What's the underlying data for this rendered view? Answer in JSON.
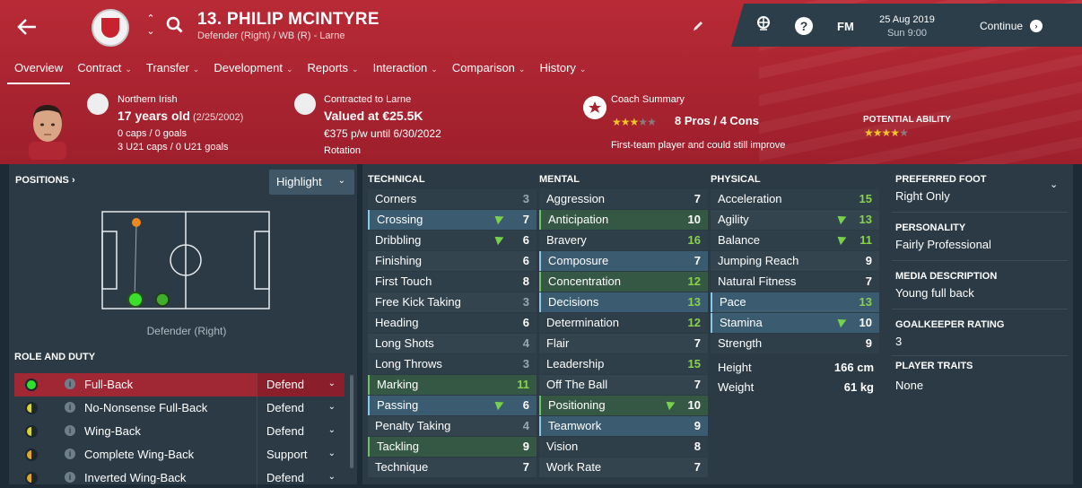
{
  "header": {
    "player_name": "13. PHILIP MCINTYRE",
    "player_sub": "Defender (Right) / WB (R) - Larne",
    "fm_label": "FM",
    "date": "25 Aug 2019",
    "time": "Sun 9:00",
    "continue_label": "Continue",
    "help_label": "?"
  },
  "nav": [
    {
      "label": "Overview",
      "active": true
    },
    {
      "label": "Contract"
    },
    {
      "label": "Transfer"
    },
    {
      "label": "Development"
    },
    {
      "label": "Reports"
    },
    {
      "label": "Interaction"
    },
    {
      "label": "Comparison"
    },
    {
      "label": "History"
    }
  ],
  "info": {
    "nationality": "Northern Irish",
    "age": "17 years old",
    "dob": "(2/25/2002)",
    "caps": "0 caps / 0 goals",
    "u21caps": "3 U21 caps / 0 U21 goals",
    "contract_label": "Contracted to Larne",
    "value": "Valued at €25.5K",
    "wage": "€375 p/w until 6/30/2022",
    "status": "Rotation",
    "coach_label": "Coach Summary",
    "coach_stars": 3,
    "pros_cons": "8 Pros / 4 Cons",
    "coach_note": "First-team player and could still improve",
    "pa_label": "POTENTIAL ABILITY",
    "pa_stars": 4
  },
  "positions": {
    "title": "POSITIONS ›",
    "highlight_label": "Highlight",
    "label": "Defender (Right)"
  },
  "roles": {
    "title": "ROLE AND DUTY",
    "info_glyph": "i",
    "items": [
      {
        "name": "Full-Back",
        "duty": "Defend",
        "selected": true,
        "color": "#2fe02f",
        "half": false
      },
      {
        "name": "No-Nonsense Full-Back",
        "duty": "Defend",
        "color": "#d8d430",
        "half": true
      },
      {
        "name": "Wing-Back",
        "duty": "Defend",
        "color": "#d8d430",
        "half": true
      },
      {
        "name": "Complete Wing-Back",
        "duty": "Support",
        "color": "#e0a82a",
        "half": true
      },
      {
        "name": "Inverted Wing-Back",
        "duty": "Defend",
        "color": "#e0a82a",
        "half": true
      }
    ]
  },
  "technical": {
    "title": "TECHNICAL",
    "rows": [
      {
        "n": "Corners",
        "v": "3",
        "style": "plain",
        "vc": "grey"
      },
      {
        "n": "Crossing",
        "v": "7",
        "style": "blue",
        "arrow": true,
        "vc": "white"
      },
      {
        "n": "Dribbling",
        "v": "6",
        "style": "plain",
        "arrow": true,
        "vc": "white"
      },
      {
        "n": "Finishing",
        "v": "6",
        "style": "alt",
        "vc": "white"
      },
      {
        "n": "First Touch",
        "v": "8",
        "style": "plain",
        "vc": "white"
      },
      {
        "n": "Free Kick Taking",
        "v": "3",
        "style": "alt",
        "vc": "grey"
      },
      {
        "n": "Heading",
        "v": "6",
        "style": "plain",
        "vc": "white"
      },
      {
        "n": "Long Shots",
        "v": "4",
        "style": "alt",
        "vc": "grey"
      },
      {
        "n": "Long Throws",
        "v": "3",
        "style": "plain",
        "vc": "grey"
      },
      {
        "n": "Marking",
        "v": "11",
        "style": "green",
        "vc": "green"
      },
      {
        "n": "Passing",
        "v": "6",
        "style": "blue",
        "arrow": true,
        "vc": "white"
      },
      {
        "n": "Penalty Taking",
        "v": "4",
        "style": "alt",
        "vc": "grey"
      },
      {
        "n": "Tackling",
        "v": "9",
        "style": "green",
        "vc": "white"
      },
      {
        "n": "Technique",
        "v": "7",
        "style": "alt",
        "vc": "white"
      }
    ]
  },
  "mental": {
    "title": "MENTAL",
    "rows": [
      {
        "n": "Aggression",
        "v": "7",
        "style": "plain",
        "vc": "white"
      },
      {
        "n": "Anticipation",
        "v": "10",
        "style": "green",
        "vc": "white"
      },
      {
        "n": "Bravery",
        "v": "16",
        "style": "plain",
        "vc": "green"
      },
      {
        "n": "Composure",
        "v": "7",
        "style": "blue",
        "vc": "white"
      },
      {
        "n": "Concentration",
        "v": "12",
        "style": "green",
        "vc": "green"
      },
      {
        "n": "Decisions",
        "v": "13",
        "style": "blue",
        "vc": "green"
      },
      {
        "n": "Determination",
        "v": "12",
        "style": "plain",
        "vc": "green"
      },
      {
        "n": "Flair",
        "v": "7",
        "style": "alt",
        "vc": "white"
      },
      {
        "n": "Leadership",
        "v": "15",
        "style": "plain",
        "vc": "green"
      },
      {
        "n": "Off The Ball",
        "v": "7",
        "style": "alt",
        "vc": "white"
      },
      {
        "n": "Positioning",
        "v": "10",
        "style": "green",
        "arrow": true,
        "vc": "white"
      },
      {
        "n": "Teamwork",
        "v": "9",
        "style": "blue",
        "vc": "white"
      },
      {
        "n": "Vision",
        "v": "8",
        "style": "plain",
        "vc": "white"
      },
      {
        "n": "Work Rate",
        "v": "7",
        "style": "alt",
        "vc": "white"
      }
    ]
  },
  "physical": {
    "title": "PHYSICAL",
    "rows": [
      {
        "n": "Acceleration",
        "v": "15",
        "style": "plain",
        "vc": "green"
      },
      {
        "n": "Agility",
        "v": "13",
        "style": "alt",
        "arrow": true,
        "vc": "green"
      },
      {
        "n": "Balance",
        "v": "11",
        "style": "plain",
        "arrow": true,
        "vc": "green"
      },
      {
        "n": "Jumping Reach",
        "v": "9",
        "style": "alt",
        "vc": "white"
      },
      {
        "n": "Natural Fitness",
        "v": "7",
        "style": "plain",
        "vc": "white"
      },
      {
        "n": "Pace",
        "v": "13",
        "style": "blue",
        "vc": "green"
      },
      {
        "n": "Stamina",
        "v": "10",
        "style": "blue",
        "arrow": true,
        "vc": "white"
      },
      {
        "n": "Strength",
        "v": "9",
        "style": "plain",
        "vc": "white"
      }
    ],
    "height_label": "Height",
    "height": "166 cm",
    "weight_label": "Weight",
    "weight": "61 kg"
  },
  "side": {
    "foot_title": "PREFERRED FOOT",
    "foot": "Right Only",
    "personality_title": "PERSONALITY",
    "personality": "Fairly Professional",
    "media_title": "MEDIA DESCRIPTION",
    "media": "Young full back",
    "gk_title": "GOALKEEPER RATING",
    "gk": "3",
    "traits_title": "PLAYER TRAITS",
    "traits": "None"
  }
}
